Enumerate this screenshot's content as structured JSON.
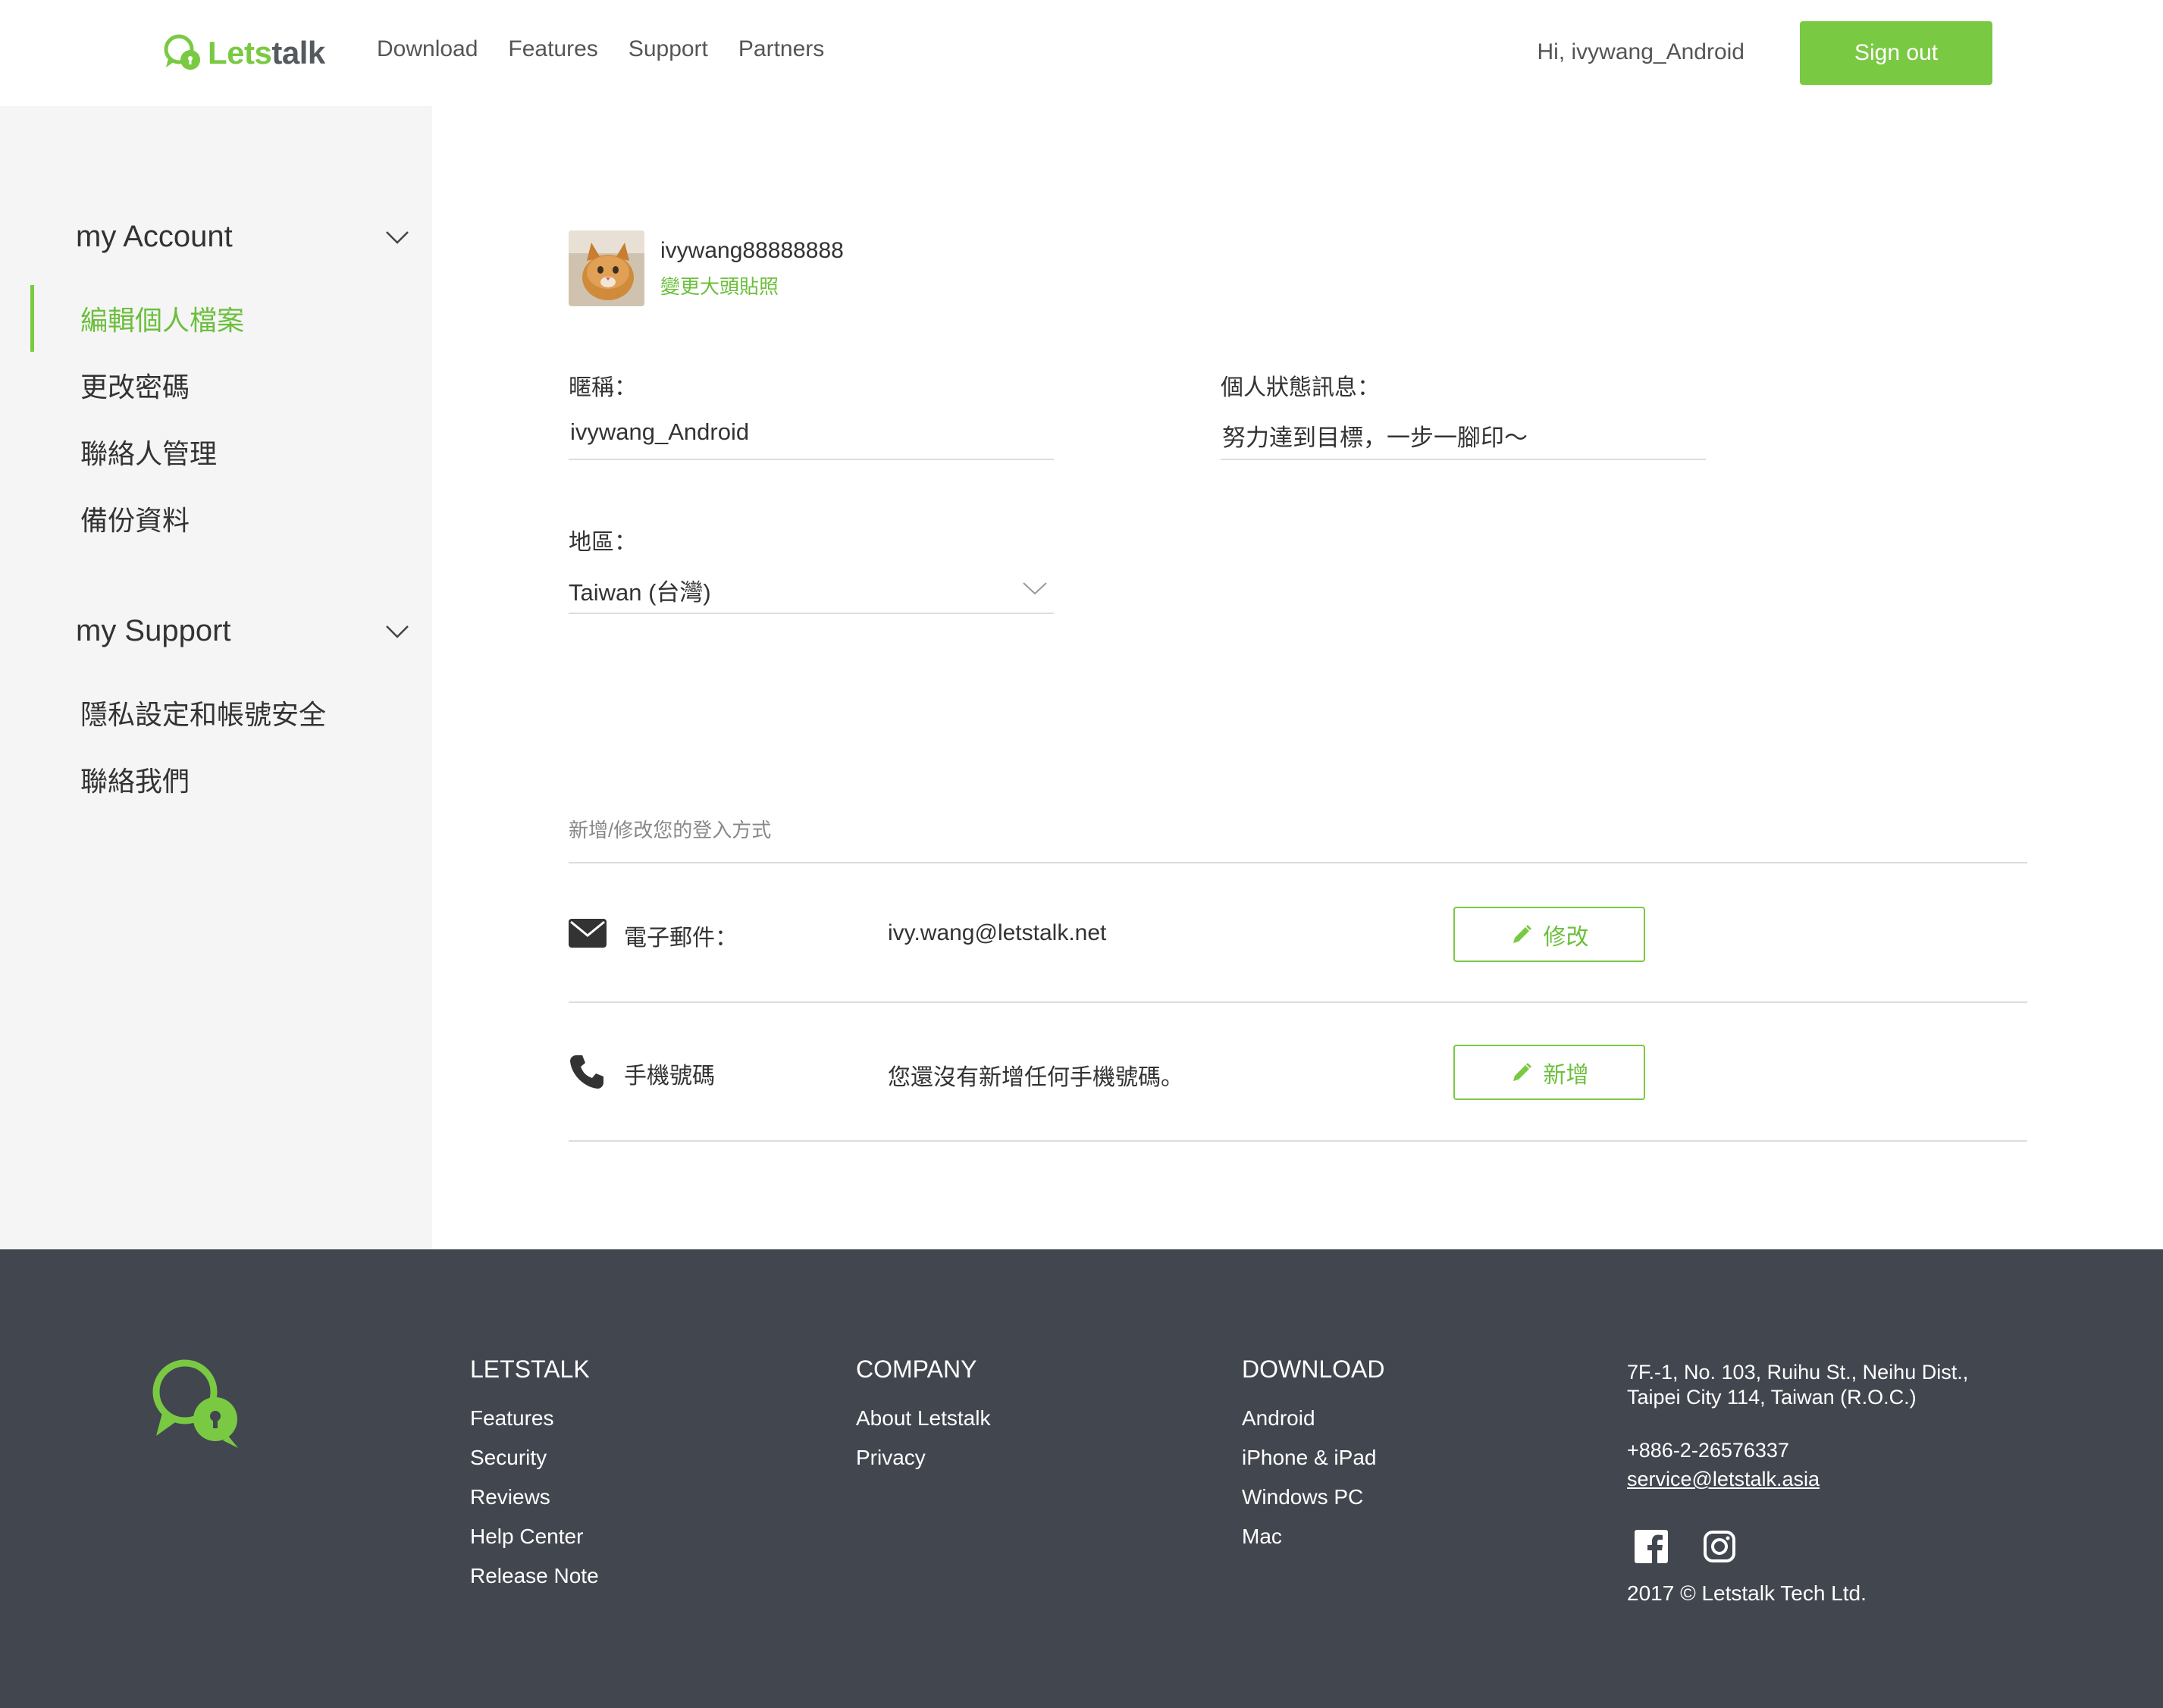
{
  "header": {
    "logo_text_green": "Lets",
    "logo_text_dark": "talk",
    "nav": [
      "Download",
      "Features",
      "Support",
      "Partners"
    ],
    "greeting": "Hi, ivywang_Android",
    "signout_label": "Sign out",
    "brand_color": "#7ac943"
  },
  "sidebar": {
    "account_title": "my Account",
    "account_items": [
      "編輯個人檔案",
      "更改密碼",
      "聯絡人管理",
      "備份資料"
    ],
    "support_title": "my Support",
    "support_items": [
      "隱私設定和帳號安全",
      "聯絡我們"
    ]
  },
  "profile": {
    "username": "ivywang88888888",
    "change_photo": "變更大頭貼照",
    "nickname_label": "暱稱：",
    "nickname_value": "ivywang_Android",
    "status_label": "個人狀態訊息：",
    "status_value": "努力達到目標，一步一腳印～",
    "region_label": "地區：",
    "region_value": "Taiwan (台灣)"
  },
  "login": {
    "title": "新增/修改您的登入方式",
    "email_label": "電子郵件：",
    "email_value": "ivy.wang@letstalk.net",
    "email_button": "修改",
    "phone_label": "手機號碼",
    "phone_value": "您還沒有新增任何手機號碼。",
    "phone_button": "新增"
  },
  "footer": {
    "col1_title": "LETSTALK",
    "col1_links": [
      "Features",
      "Security",
      "Reviews",
      "Help Center",
      "Release Note"
    ],
    "col2_title": "COMPANY",
    "col2_links": [
      "About Letstalk",
      "Privacy"
    ],
    "col3_title": "DOWNLOAD",
    "col3_links": [
      "Android",
      "iPhone & iPad",
      "Windows PC",
      "Mac"
    ],
    "address_line1": "7F.-1, No. 103, Ruihu St., Neihu Dist.,",
    "address_line2": "Taipei City 114, Taiwan (R.O.C.)",
    "phone": "+886-2-26576337",
    "email": "service@letstalk.asia",
    "copyright": "2017 © Letstalk Tech Ltd."
  }
}
